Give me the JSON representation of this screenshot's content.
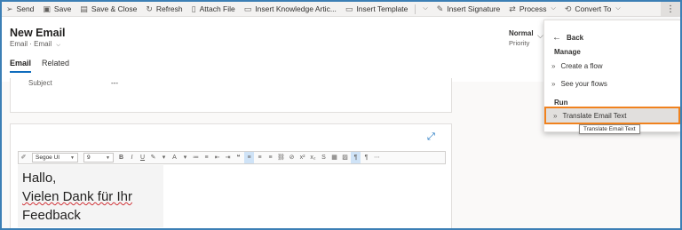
{
  "command_bar": {
    "items": [
      {
        "label": "Send",
        "icon": "send-icon"
      },
      {
        "label": "Save",
        "icon": "save-icon"
      },
      {
        "label": "Save & Close",
        "icon": "save-close-icon"
      },
      {
        "label": "Refresh",
        "icon": "refresh-icon"
      },
      {
        "label": "Attach File",
        "icon": "attach-icon"
      },
      {
        "label": "Insert Knowledge Artic...",
        "icon": "knowledge-icon"
      },
      {
        "label": "Insert Template",
        "icon": "template-icon"
      },
      {
        "label": "Insert Signature",
        "icon": "signature-icon"
      },
      {
        "label": "Process",
        "icon": "process-icon"
      },
      {
        "label": "Convert To",
        "icon": "convert-icon"
      }
    ],
    "more_icon": "more-vertical-icon"
  },
  "header": {
    "title": "New Email",
    "entity": "Email",
    "form": "Email",
    "priority_value": "Normal",
    "priority_label": "Priority"
  },
  "tabs": [
    {
      "label": "Email",
      "active": true
    },
    {
      "label": "Related",
      "active": false
    }
  ],
  "form": {
    "subject_label": "Subject",
    "subject_value": "---"
  },
  "editor": {
    "font": "Segoe UI",
    "size": "9",
    "lines": [
      "Hallo,",
      "Vielen Dank für Ihr",
      "Feedback"
    ]
  },
  "flyout": {
    "back": "Back",
    "manage_label": "Manage",
    "create_flow": "Create a flow",
    "see_flows": "See your flows",
    "run_label": "Run",
    "translate": "Translate Email Text"
  },
  "tooltip": "Translate Email Text",
  "colors": {
    "accent": "#0f6cbd",
    "highlight_border": "#f0821e",
    "frame": "#3c7fb5"
  }
}
